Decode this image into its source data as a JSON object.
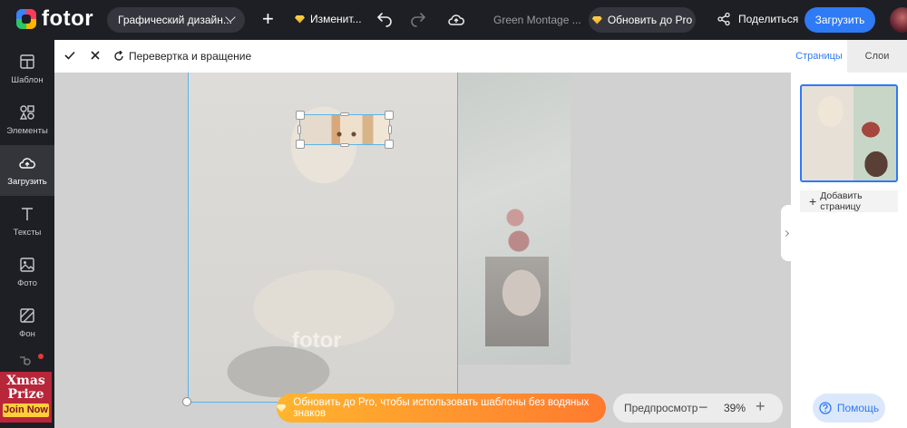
{
  "app": {
    "logo_text": "fotor",
    "design_type": "Графический дизайн...",
    "change_label": "Изменит...",
    "document_name": "Green Montage ...",
    "upgrade_label": "Обновить до Pro",
    "share_label": "Поделиться",
    "upload_label": "Загрузить"
  },
  "sidebar": {
    "items": [
      {
        "label": "Шаблон",
        "icon": "template-icon"
      },
      {
        "label": "Элементы",
        "icon": "elements-icon"
      },
      {
        "label": "Загрузить",
        "icon": "upload-icon",
        "active": true
      },
      {
        "label": "Тексты",
        "icon": "text-icon"
      },
      {
        "label": "Фото",
        "icon": "photo-icon"
      },
      {
        "label": "Фон",
        "icon": "background-icon"
      }
    ],
    "promo": {
      "line1": "Xmas",
      "line2": "Prize",
      "cta": "Join Now"
    }
  },
  "edit_toolbar": {
    "flip_rotate_label": "Перевертка и вращение"
  },
  "canvas": {
    "watermark": "fotor"
  },
  "bottom": {
    "pro_banner": "Обновить до Pro, чтобы использовать шаблоны без водяных знаков",
    "preview_label": "Предпросмотр",
    "zoom_value": "39%",
    "help_label": "Помощь"
  },
  "right_panel": {
    "tabs": [
      {
        "label": "Страницы",
        "active": true
      },
      {
        "label": "Слои"
      }
    ],
    "add_page_label": "Добавить страницу"
  },
  "colors": {
    "accent": "#2f7af5",
    "topbar": "#1e1f24",
    "pro_gradient_start": "#ffb52e",
    "pro_gradient_end": "#ff7a2f",
    "selection": "#5ab4e6"
  }
}
